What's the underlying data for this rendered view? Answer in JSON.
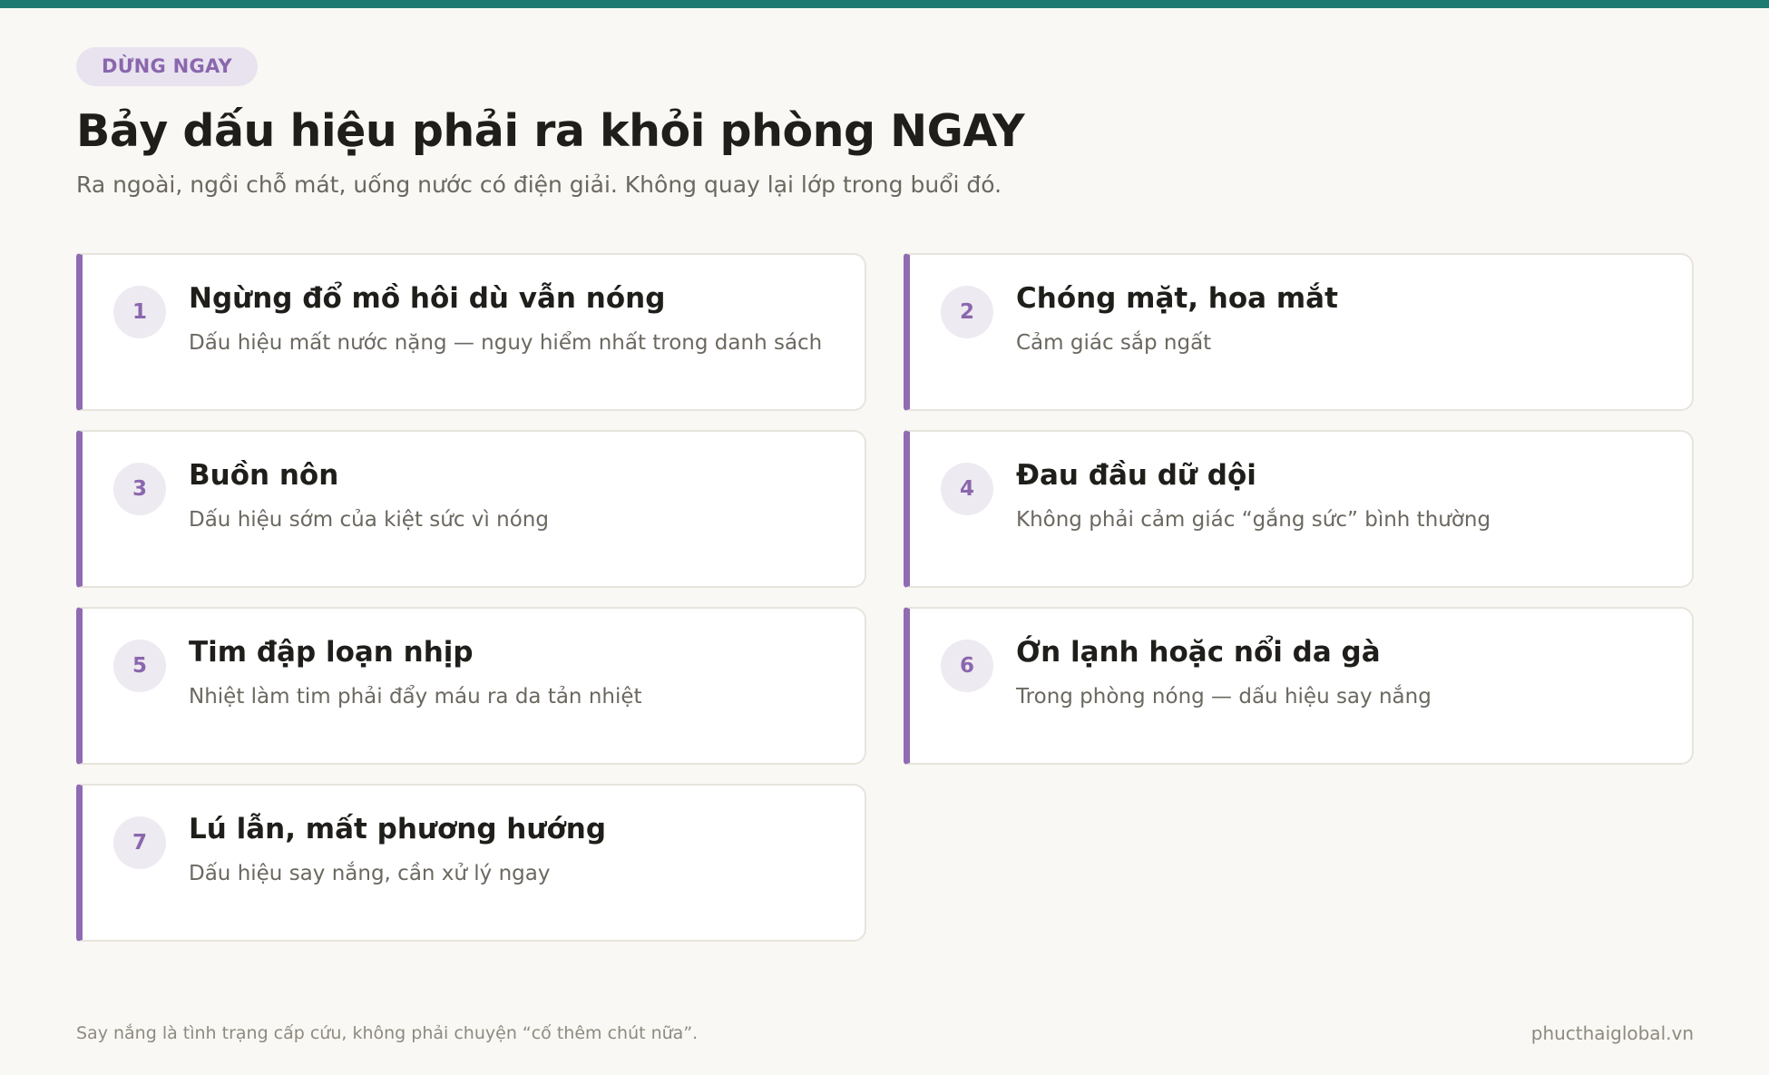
{
  "badge": "DỪNG NGAY",
  "title": "Bảy dấu hiệu phải ra khỏi phòng NGAY",
  "subtitle": "Ra ngoài, ngồi chỗ mát, uống nước có điện giải. Không quay lại lớp trong buổi đó.",
  "colors": {
    "accent": "#8f6bb3",
    "top_bar": "#1f7a72",
    "background": "#f9f8f4"
  },
  "signs": [
    {
      "number": "1",
      "title": "Ngừng đổ mồ hôi dù vẫn nóng",
      "desc": "Dấu hiệu mất nước nặng — nguy hiểm nhất trong danh sách"
    },
    {
      "number": "2",
      "title": "Chóng mặt, hoa mắt",
      "desc": "Cảm giác sắp ngất"
    },
    {
      "number": "3",
      "title": "Buồn nôn",
      "desc": "Dấu hiệu sớm của kiệt sức vì nóng"
    },
    {
      "number": "4",
      "title": "Đau đầu dữ dội",
      "desc": "Không phải cảm giác “gắng sức” bình thường"
    },
    {
      "number": "5",
      "title": "Tim đập loạn nhịp",
      "desc": "Nhiệt làm tim phải đẩy máu ra da tản nhiệt"
    },
    {
      "number": "6",
      "title": "Ớn lạnh hoặc nổi da gà",
      "desc": "Trong phòng nóng — dấu hiệu say nắng"
    },
    {
      "number": "7",
      "title": "Lú lẫn, mất phương hướng",
      "desc": "Dấu hiệu say nắng, cần xử lý ngay"
    }
  ],
  "footer": {
    "note": "Say nắng là tình trạng cấp cứu, không phải chuyện “cố thêm chút nữa”.",
    "site": "phucthaiglobal.vn"
  }
}
